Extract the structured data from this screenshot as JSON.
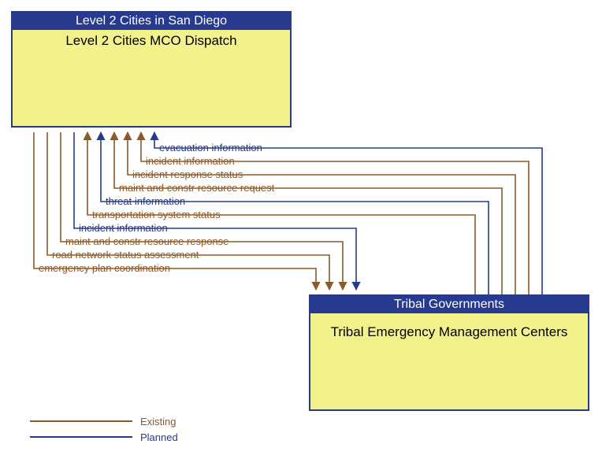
{
  "chart_data": {
    "type": "diagram",
    "nodes": [
      {
        "id": "node_a",
        "group": "Level 2 Cities in San Diego",
        "title": "Level 2 Cities MCO Dispatch"
      },
      {
        "id": "node_b",
        "group": "Tribal Governments",
        "title": "Tribal Emergency Management Centers"
      }
    ],
    "flows": [
      {
        "label": "evacuation information",
        "from": "node_b",
        "to": "node_a",
        "status": "planned"
      },
      {
        "label": "incident information",
        "from": "node_b",
        "to": "node_a",
        "status": "existing"
      },
      {
        "label": "incident response status",
        "from": "node_b",
        "to": "node_a",
        "status": "existing"
      },
      {
        "label": "maint and constr resource request",
        "from": "node_b",
        "to": "node_a",
        "status": "existing"
      },
      {
        "label": "threat information",
        "from": "node_b",
        "to": "node_a",
        "status": "planned"
      },
      {
        "label": "transportation system status",
        "from": "node_b",
        "to": "node_a",
        "status": "existing"
      },
      {
        "label": "incident information",
        "from": "node_a",
        "to": "node_b",
        "status": "planned"
      },
      {
        "label": "maint and constr resource response",
        "from": "node_a",
        "to": "node_b",
        "status": "existing"
      },
      {
        "label": "road network status assessment",
        "from": "node_a",
        "to": "node_b",
        "status": "existing"
      },
      {
        "label": "emergency plan coordination",
        "from": "node_a",
        "to": "node_b",
        "status": "existing"
      }
    ],
    "legend": [
      {
        "label": "Existing",
        "color": "#8a5a2a"
      },
      {
        "label": "Planned",
        "color": "#273a8f"
      }
    ],
    "colors": {
      "existing": "#8a5a2a",
      "planned": "#273a8f"
    }
  }
}
